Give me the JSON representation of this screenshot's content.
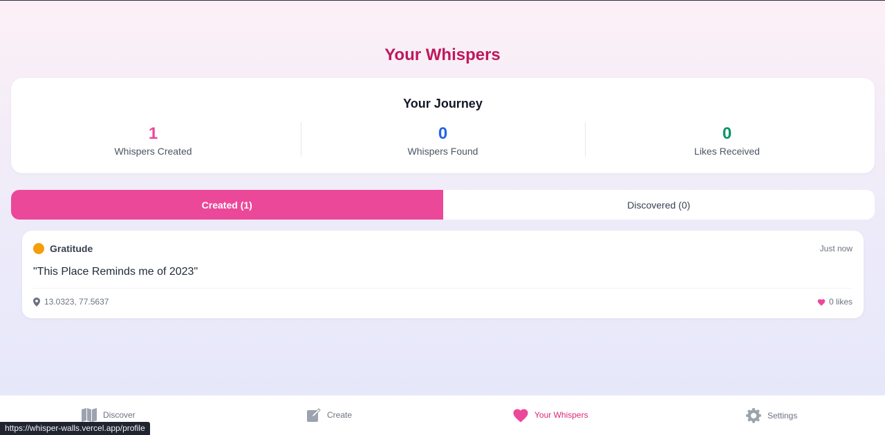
{
  "page": {
    "title": "Your Whispers"
  },
  "journey": {
    "title": "Your Journey",
    "stats": [
      {
        "value": "1",
        "label": "Whispers Created",
        "color": "#ec4899"
      },
      {
        "value": "0",
        "label": "Whispers Found",
        "color": "#2563eb"
      },
      {
        "value": "0",
        "label": "Likes Received",
        "color": "#059669"
      }
    ]
  },
  "tabs": [
    {
      "label": "Created (1)",
      "active": true
    },
    {
      "label": "Discovered (0)",
      "active": false
    }
  ],
  "whispers": [
    {
      "mood": "Gratitude",
      "mood_color": "#f59e0b",
      "time": "Just now",
      "message": "\"This Place Reminds me of 2023\"",
      "location": "13.0323, 77.5637",
      "likes": "0 likes"
    }
  ],
  "nav": [
    {
      "label": "Discover",
      "icon": "map-icon",
      "active": false
    },
    {
      "label": "Create",
      "icon": "edit-icon",
      "active": false
    },
    {
      "label": "Your Whispers",
      "icon": "heart-icon",
      "active": true
    },
    {
      "label": "Settings",
      "icon": "gear-icon",
      "active": false
    }
  ],
  "status_bar": {
    "url": "https://whisper-walls.vercel.app/profile"
  },
  "colors": {
    "accent": "#ec4899",
    "title": "#be185d"
  }
}
